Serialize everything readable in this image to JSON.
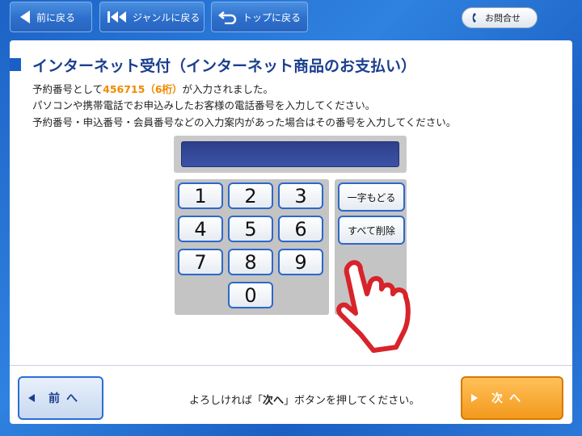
{
  "nav": {
    "back_label": "前に戻る",
    "genre_label": "ジャンルに戻る",
    "top_label": "トップに戻る",
    "contact_label": "お問合せ"
  },
  "page": {
    "title": "インターネット受付（インターネット商品のお支払い）",
    "info_prefix": "予約番号として",
    "info_number": "456715（6桁）",
    "info_suffix": "が入力されました。",
    "info_line2": "パソコンや携帯電話でお申込みしたお客様の電話番号を入力してください。",
    "info_line3": "予約番号・申込番号・会員番号などの入力案内があった場合はその番号を入力してください。"
  },
  "display": {
    "value": ""
  },
  "keypad": {
    "keys": [
      "1",
      "2",
      "3",
      "4",
      "5",
      "6",
      "7",
      "8",
      "9",
      "0"
    ],
    "backspace_label": "一字もどる",
    "clear_label": "すべて削除"
  },
  "footer": {
    "prev_label": "前へ",
    "next_label": "次へ",
    "msg_before": "よろしければ「",
    "msg_bold": "次へ",
    "msg_after": "」ボタンを押してください。"
  },
  "colors": {
    "background": "#2a78d8",
    "title": "#1b3f8f",
    "highlight": "#f08a00",
    "next_button": "#f39a1c",
    "key_border": "#2c68c9",
    "hand": "#d8232a"
  },
  "icons": {
    "back": "triangle-left-icon",
    "genre": "double-skip-left-icon",
    "top": "return-arrow-icon",
    "contact": "phone-icon",
    "hand": "pointing-hand-icon",
    "prev": "triangle-left-icon",
    "next": "triangle-right-icon"
  }
}
